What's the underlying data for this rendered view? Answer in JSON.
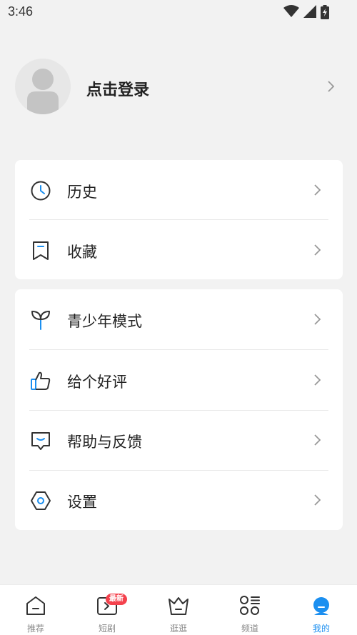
{
  "status_bar": {
    "time": "3:46",
    "icons": [
      "wifi-icon",
      "signal-icon",
      "battery-charging-icon"
    ]
  },
  "profile": {
    "login_label": "点击登录",
    "avatar_icon": "default-avatar-icon"
  },
  "menu_group_1": [
    {
      "label": "历史",
      "icon": "clock-icon"
    },
    {
      "label": "收藏",
      "icon": "bookmark-icon"
    }
  ],
  "menu_group_2": [
    {
      "label": "青少年模式",
      "icon": "sprout-icon"
    },
    {
      "label": "给个好评",
      "icon": "thumbs-up-icon"
    },
    {
      "label": "帮助与反馈",
      "icon": "feedback-icon"
    },
    {
      "label": "设置",
      "icon": "settings-hexagon-icon"
    }
  ],
  "bottom_nav": {
    "items": [
      {
        "label": "推荐",
        "icon": "home-icon",
        "active": false
      },
      {
        "label": "短剧",
        "icon": "short-drama-icon",
        "active": false,
        "badge": "最新"
      },
      {
        "label": "逛逛",
        "icon": "basket-icon",
        "active": false
      },
      {
        "label": "频道",
        "icon": "channels-grid-icon",
        "active": false
      },
      {
        "label": "我的",
        "icon": "profile-icon",
        "active": true
      }
    ]
  },
  "colors": {
    "accent": "#1b8ff0",
    "badge": "#f4424d",
    "background": "#f2f2f2"
  }
}
